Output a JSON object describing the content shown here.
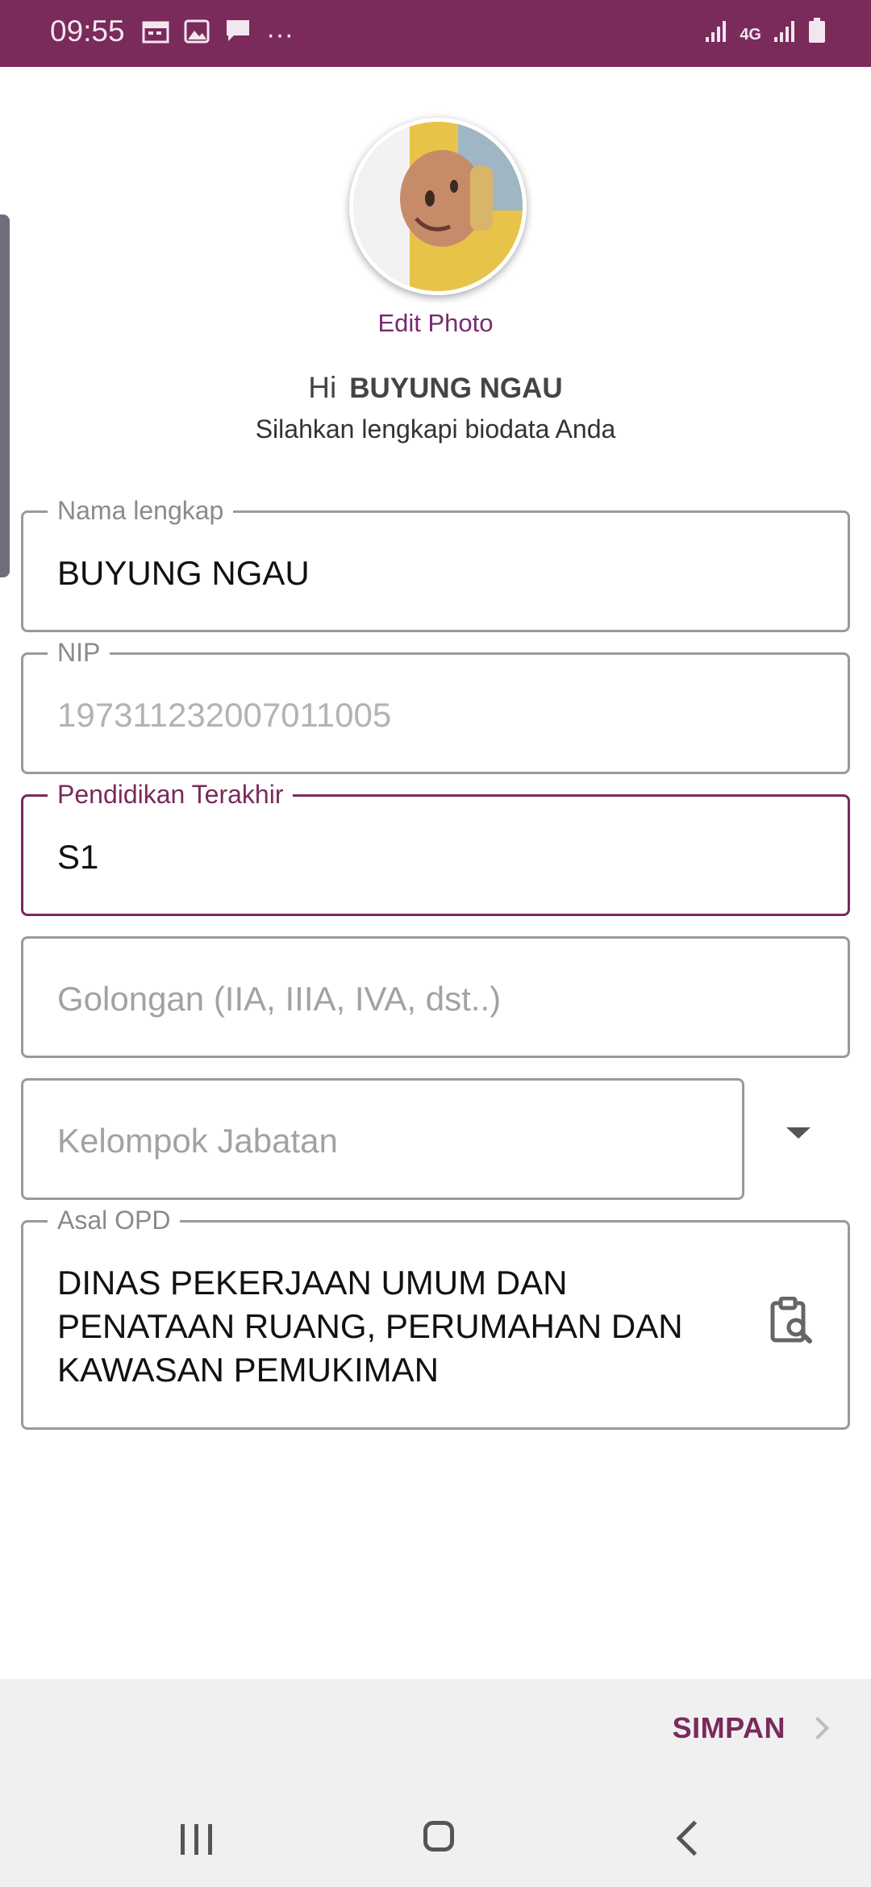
{
  "status_bar": {
    "time": "09:55",
    "left_icons": [
      "calendar-icon",
      "image-icon",
      "message-icon",
      "more-icon"
    ],
    "right_icons": [
      "signal-icon",
      "4g-icon",
      "signal-icon",
      "battery-icon"
    ],
    "network_label": "4G",
    "more_label": "···"
  },
  "profile": {
    "edit_photo_label": "Edit Photo",
    "greeting_hi": "Hi",
    "user_name": "BUYUNG NGAU",
    "subtitle": "Silahkan lengkapi biodata Anda"
  },
  "form": {
    "nama_lengkap": {
      "label": "Nama lengkap",
      "value": "BUYUNG NGAU"
    },
    "nip": {
      "label": "NIP",
      "value": "197311232007011005"
    },
    "pendidikan": {
      "label": "Pendidikan Terakhir",
      "value": "S1"
    },
    "golongan": {
      "placeholder": "Golongan (IIA, IIIA, IVA, dst..)"
    },
    "kelompok_jabatan": {
      "placeholder": "Kelompok Jabatan"
    },
    "asal_opd": {
      "label": "Asal OPD",
      "value_lines": [
        "DINAS PEKERJAAN UMUM DAN",
        "PENATAAN RUANG, PERUMAHAN DAN",
        "KAWASAN PEMUKIMAN"
      ]
    }
  },
  "footer": {
    "save_label": "SIMPAN"
  },
  "colors": {
    "primary": "#7a2a5b",
    "footer_bg": "#f0f0f0",
    "border": "#9a9a9a"
  }
}
